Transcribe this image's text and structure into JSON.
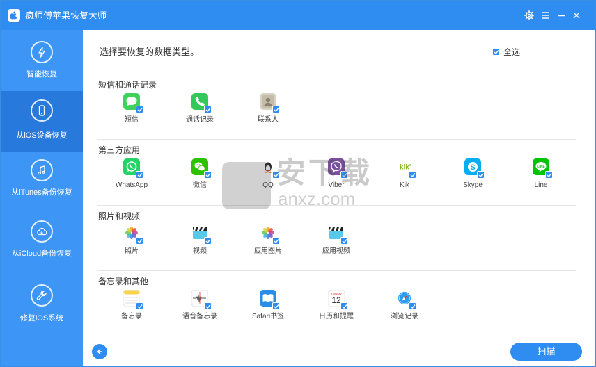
{
  "app": {
    "title": "疯师傅苹果恢复大师",
    "accent_color": "#2f8cf0",
    "icons": {
      "logo": "apple-logo-icon",
      "settings": "gear-icon",
      "menu": "menu-icon",
      "minimize": "minimize-icon",
      "close": "close-icon"
    }
  },
  "sidebar": {
    "items": [
      {
        "label": "智能恢复",
        "icon": "lightning-refresh-icon",
        "active": false
      },
      {
        "label": "从iOS设备恢复",
        "icon": "phone-refresh-icon",
        "active": true
      },
      {
        "label": "从iTunes备份恢复",
        "icon": "music-note-icon",
        "active": false
      },
      {
        "label": "从iCloud备份恢复",
        "icon": "cloud-icon",
        "active": false
      },
      {
        "label": "修复iOS系统",
        "icon": "wrench-icon",
        "active": false
      }
    ]
  },
  "main": {
    "instruction": "选择要恢复的数据类型。",
    "select_all": {
      "label": "全选",
      "checked": true
    },
    "sections": [
      {
        "title": "短信和通话记录",
        "items": [
          {
            "label": "短信",
            "icon": "messages-icon",
            "checked": true
          },
          {
            "label": "通话记录",
            "icon": "phone-icon",
            "checked": true
          },
          {
            "label": "联系人",
            "icon": "contacts-icon",
            "checked": true
          }
        ]
      },
      {
        "title": "第三方应用",
        "items": [
          {
            "label": "WhatsApp",
            "icon": "whatsapp-icon",
            "checked": true
          },
          {
            "label": "微信",
            "icon": "wechat-icon",
            "checked": true
          },
          {
            "label": "QQ",
            "icon": "qq-icon",
            "checked": true
          },
          {
            "label": "Viber",
            "icon": "viber-icon",
            "checked": true
          },
          {
            "label": "Kik",
            "icon": "kik-icon",
            "checked": true
          },
          {
            "label": "Skype",
            "icon": "skype-icon",
            "checked": true
          },
          {
            "label": "Line",
            "icon": "line-icon",
            "checked": true
          }
        ]
      },
      {
        "title": "照片和视频",
        "items": [
          {
            "label": "照片",
            "icon": "photos-icon",
            "checked": true
          },
          {
            "label": "视频",
            "icon": "clapperboard-icon",
            "checked": true
          },
          {
            "label": "应用图片",
            "icon": "photos-icon",
            "checked": true
          },
          {
            "label": "应用视频",
            "icon": "clapperboard-icon",
            "checked": true
          }
        ]
      },
      {
        "title": "备忘录和其他",
        "items": [
          {
            "label": "备忘录",
            "icon": "notes-icon",
            "checked": true
          },
          {
            "label": "语音备忘录",
            "icon": "voice-memo-icon",
            "checked": true
          },
          {
            "label": "Safari书签",
            "icon": "book-icon",
            "checked": true
          },
          {
            "label": "日历和提醒",
            "icon": "calendar-icon",
            "checked": true,
            "calendar_day": "12",
            "calendar_month": "Tuesday"
          },
          {
            "label": "浏览记录",
            "icon": "safari-compass-icon",
            "checked": true
          }
        ]
      }
    ]
  },
  "watermark": {
    "text": "安下载",
    "subtext": "anxz.com"
  },
  "footer": {
    "scan_label": "扫描",
    "back_icon": "arrow-left-icon"
  }
}
